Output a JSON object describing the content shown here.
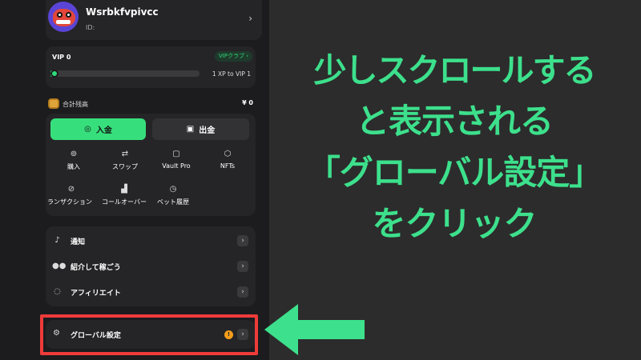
{
  "profile": {
    "username": "Wsrbkfvpivcc",
    "id_label": "ID:"
  },
  "vip": {
    "level_label": "VIP 0",
    "club_label": "VIPクラブ ›",
    "progress_text": "1 XP to VIP 1",
    "progress_fraction": 0.02
  },
  "balance": {
    "label": "合計残高",
    "value": "¥ 0"
  },
  "actions": {
    "deposit_label": "入金",
    "withdraw_label": "出金",
    "grid": [
      {
        "label": "購入",
        "icon": "coin-cycle-icon"
      },
      {
        "label": "スワップ",
        "icon": "swap-icon"
      },
      {
        "label": "Vault Pro",
        "icon": "vault-icon"
      },
      {
        "label": "NFTs",
        "icon": "nft-icon"
      },
      {
        "label": "ランザクション",
        "icon": "transaction-icon"
      },
      {
        "label": "コールオーバー",
        "icon": "rollover-icon"
      },
      {
        "label": "ベット履歴",
        "icon": "clock-icon"
      }
    ]
  },
  "menu": {
    "items": [
      {
        "label": "通知",
        "icon": "bell-icon"
      },
      {
        "label": "紹介して稼ごう",
        "icon": "users-icon"
      },
      {
        "label": "アフィリエイト",
        "icon": "affiliate-icon"
      }
    ],
    "global_settings_label": "グローバル設定"
  },
  "caption": {
    "lines": [
      "少しスクロールする",
      "と表示される",
      "「グローバル設定」",
      "をクリック"
    ],
    "color": "#3de08c"
  },
  "colors": {
    "accent_green": "#37df7c",
    "highlight_red": "#ef3b3b",
    "warning_orange": "#f59e1b"
  }
}
